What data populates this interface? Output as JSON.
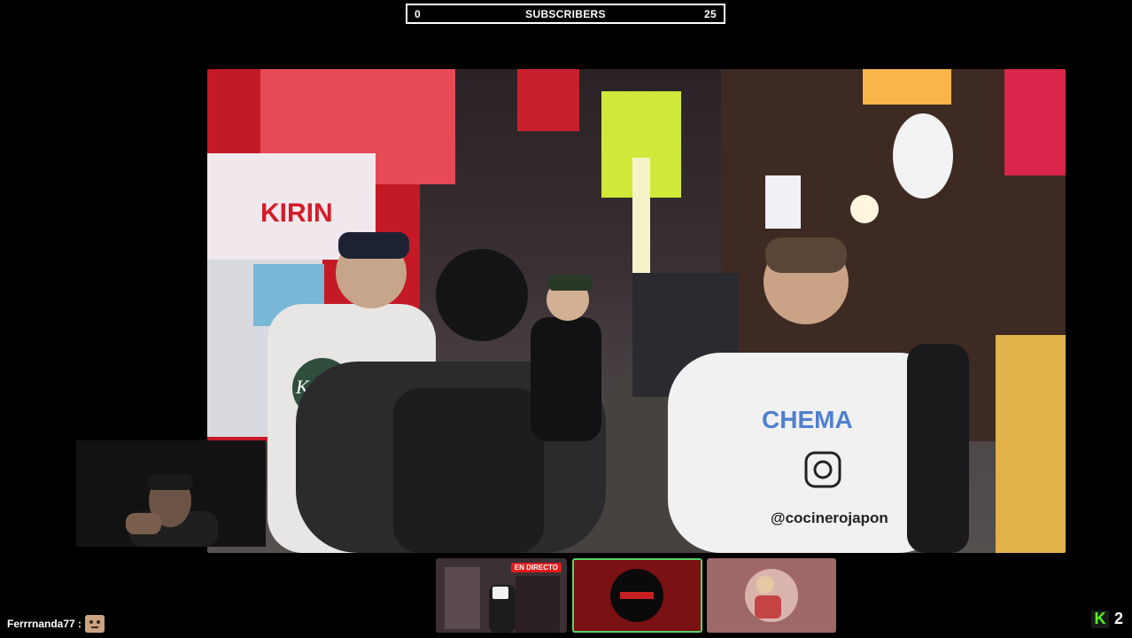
{
  "subscribers_bar": {
    "left_count": "0",
    "title": "SUBSCRIBERS",
    "right_count": "25"
  },
  "stream_scene": {
    "signs": {
      "kirin": "KIRIN",
      "shirt_brand": "CHEMA",
      "shirt_handle": "@cocinerojapon",
      "kebo": "Kebo"
    }
  },
  "thumbnails": [
    {
      "badge": "EN DIRECTO"
    },
    {},
    {}
  ],
  "chat": {
    "username": "Ferrrnanda77 :"
  },
  "footer": {
    "viewer_count": "2"
  },
  "colors": {
    "accent_green": "#53fc18",
    "live_red": "#e01b1b"
  }
}
